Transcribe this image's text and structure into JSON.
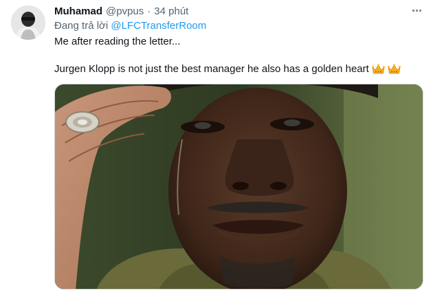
{
  "tweet": {
    "display_name": "Muhamad",
    "handle": "@pvpus",
    "separator": "·",
    "time": "34 phút",
    "reply_prefix": "Đang trả lời",
    "reply_to": "@LFCTransferRoom",
    "text_line_1": "Me after reading the letter...",
    "text_line_2": "Jurgen Klopp is not just the best manager he also has a golden heart",
    "emojis": [
      "crown-icon",
      "crown-icon"
    ]
  },
  "colors": {
    "link": "#1d9bf0",
    "secondary_text": "#536471",
    "primary_text": "#0f1419"
  }
}
